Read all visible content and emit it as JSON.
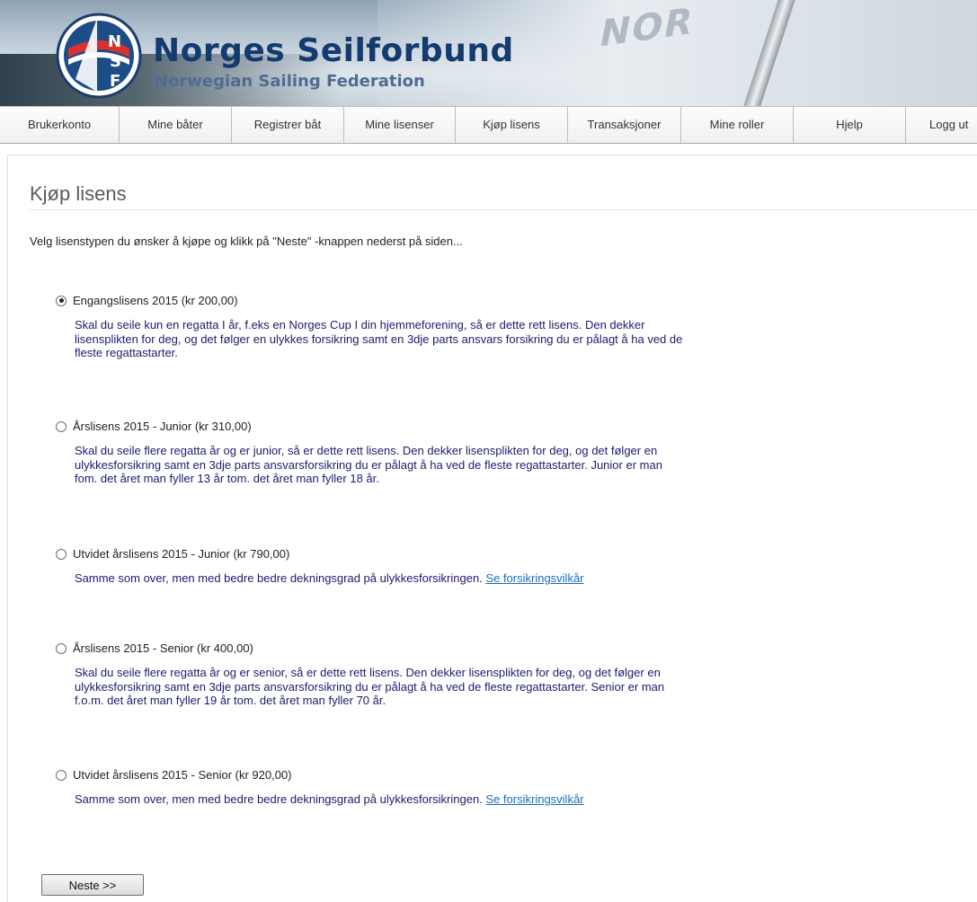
{
  "header": {
    "logo_letters": "NSF",
    "brand_title": "Norges Seilforbund",
    "brand_subtitle": "Norwegian Sailing Federation",
    "sail_text": "NOR"
  },
  "nav": {
    "items": [
      {
        "label": "Brukerkonto"
      },
      {
        "label": "Mine båter"
      },
      {
        "label": "Registrer båt"
      },
      {
        "label": "Mine lisenser"
      },
      {
        "label": "Kjøp lisens"
      },
      {
        "label": "Transaksjoner"
      },
      {
        "label": "Mine roller"
      },
      {
        "label": "Hjelp"
      },
      {
        "label": "Logg ut"
      }
    ]
  },
  "page": {
    "title": "Kjøp lisens",
    "intro": "Velg lisenstypen du ønsker å kjøpe og klikk på \"Neste\" -knappen nederst på siden..."
  },
  "options": [
    {
      "label": "Engangslisens 2015 (kr 200,00)",
      "selected": true,
      "lines": [
        "Skal du seile kun en regatta I år, f.eks en Norges Cup I din hjemmeforening, så er dette rett lisens. Den dekker",
        "lisensplikten for deg, og det følger en ulykkes forsikring samt en 3dje parts ansvars forsikring du er pålagt å ha ved de",
        "fleste regattastarter."
      ]
    },
    {
      "label": "Årslisens 2015 - Junior (kr 310,00)",
      "selected": false,
      "lines": [
        "Skal du seile flere regatta år og er junior, så er dette rett lisens. Den dekker lisensplikten for deg, og det følger en",
        "ulykkesforsikring samt en 3dje parts ansvarsforsikring du er pålagt å ha ved de fleste regattastarter. Junior er man",
        "fom. det året man fyller 13 år tom. det året man fyller 18 år."
      ]
    },
    {
      "label": "Utvidet årslisens 2015 - Junior (kr 790,00)",
      "selected": false,
      "text": "Samme som over, men med bedre bedre dekningsgrad på ulykkesforsikringen.",
      "link": "Se forsikringsvilkår"
    },
    {
      "label": "Årslisens 2015 - Senior (kr 400,00)",
      "selected": false,
      "lines": [
        "Skal du seile flere regatta år og er senior, så er dette rett lisens. Den dekker lisensplikten for deg, og det følger en",
        "ulykkesforsikring samt en 3dje parts ansvarsforsikring du er pålagt å ha ved de fleste regattastarter. Senior er man",
        "f.o.m. det året man fyller 19 år tom. det året man fyller 70 år."
      ]
    },
    {
      "label": "Utvidet årslisens 2015 - Senior (kr 920,00)",
      "selected": false,
      "text": "Samme som over, men med bedre bedre dekningsgrad på ulykkesforsikringen.",
      "link": "Se forsikringsvilkår"
    }
  ],
  "actions": {
    "next_label": "Neste >>"
  },
  "colors": {
    "brand": "#133b6e",
    "description_text": "#1c1c6e",
    "link": "#1a6fbe"
  }
}
